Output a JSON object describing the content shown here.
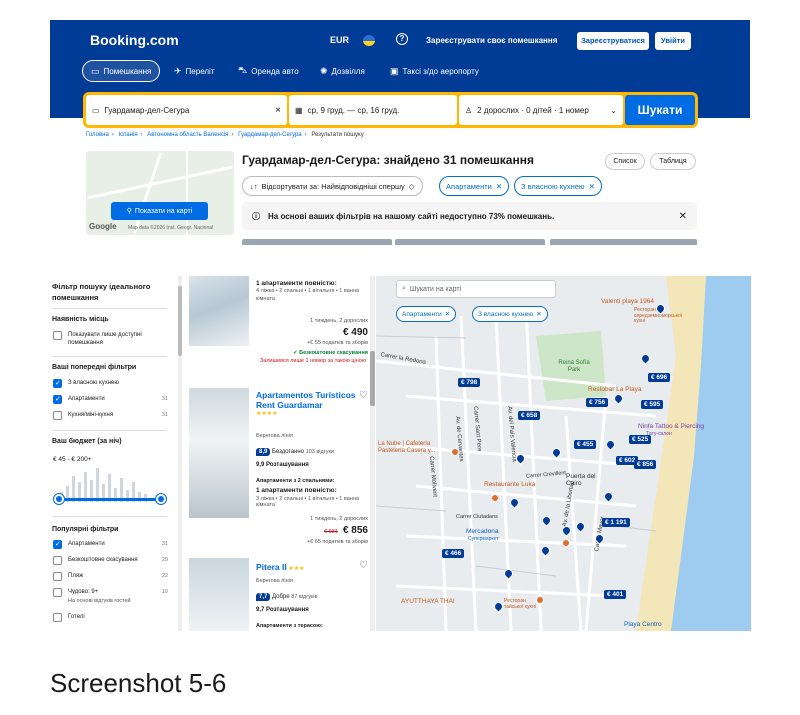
{
  "header": {
    "logo": "Booking.com",
    "currency": "EUR",
    "register_property": "Зареєструвати своє помешкання",
    "signup": "Зареєструватися",
    "signin": "Увійти",
    "nav": [
      "Помешкання",
      "Переліт",
      "Оренда авто",
      "Дозвілля",
      "Таксі з/до аеропорту"
    ]
  },
  "search": {
    "destination": "Гуардамар-дел-Сегура",
    "dates": "ср, 9 груд. — ср, 16 груд.",
    "guests": "2 дорослих · 0 дітей · 1 номер",
    "button": "Шукати"
  },
  "breadcrumbs": [
    "Головна",
    "Іспанія",
    "Автономна область Валенсія",
    "Гуардамар-дел-Сегура",
    "Результати пошуку"
  ],
  "results": {
    "map_button": "Показати на карті",
    "map_data": "Map data ©2026 Inst. Geogr. Nacional",
    "title": "Гуардамар-дел-Сегура: знайдено 31 помешкання",
    "view_list": "Список",
    "view_table": "Таблиця",
    "sort": "Відсортувати за: Найвідповідніші спершу",
    "chips": [
      "Апартаменти",
      "З власною кухнею"
    ],
    "notice": "На основі ваших фільтрів на нашому сайті недоступно 73% помешкань."
  },
  "filters": {
    "title": "Фільтр пошуку ідеального помешкання",
    "availability": "Наявність місць",
    "availability_item": "Показувати лише доступні помешкання",
    "previous": "Ваші попередні фільтри",
    "previous_items": [
      {
        "label": "З власною кухнею",
        "count": ""
      },
      {
        "label": "Апартаменти",
        "count": "31"
      },
      {
        "label": "Кухня/міні-кухня",
        "count": "31"
      }
    ],
    "budget": "Ваш бюджет (за ніч)",
    "budget_range": "€ 45 - € 200+",
    "popular": "Популярні фільтри",
    "popular_items": [
      {
        "label": "Апартаменти",
        "count": "31"
      },
      {
        "label": "Безкоштовне скасування",
        "count": "29"
      },
      {
        "label": "Пляж",
        "count": "22"
      },
      {
        "label": "Чудово: 9+",
        "count": "10"
      },
      {
        "label": "Готелі",
        "count": ""
      }
    ],
    "popular_sub": "На основі відгуків гостей"
  },
  "listings": [
    {
      "unit": "1 апартаменти повністю:",
      "beds": "4 ліжка • 2 спальні • 1 вітальня • 1 ванна кімната",
      "stay": "1 тиждень, 2 дорослих",
      "price": "€ 490",
      "fees": "+€ 55 податків та зборів",
      "free_cancel": "Безкоштовне скасування",
      "left": "Залишився лише 1 номер за такою ціною"
    },
    {
      "name": "Apartamentos Turísticos Rent Guardamar",
      "location": "Берегова лінія",
      "score": "8,9",
      "score_word": "Бездоганно",
      "reviews": "103 відгуки",
      "loc_score": "9,9 Розташування",
      "type": "Апартаменти з 2 спальнями:",
      "unit": "1 апартаменти повністю:",
      "beds": "3 ліжка • 2 спальні • 1 вітальня • 1 ванна кімната",
      "stay": "1 тиждень, 2 дорослих",
      "old_price": "€ 931",
      "price": "€ 856",
      "fees": "+€ 65 податків та зборів"
    },
    {
      "name": "Pitera II",
      "location": "Берегова лінія",
      "score": "7,7",
      "score_word": "Добре",
      "reviews": "87 відгуків",
      "loc_score": "9,7 Розташування",
      "type": "Апартаменти з терасою:"
    }
  ],
  "map": {
    "search_placeholder": "Шукати на карті",
    "chips": [
      "Апартаменти",
      "З власною кухнею"
    ],
    "prices": [
      "€ 798",
      "€ 658",
      "€ 756",
      "€ 595",
      "€ 696",
      "€ 455",
      "€ 525",
      "€ 602",
      "€ 856",
      "€ 1 191",
      "€ 466",
      "€ 401"
    ],
    "places": [
      "Valenti playa 1964",
      "Ресторан середземноморської кухні",
      "Carrer la Redona",
      "Reina Sofía Park",
      "Restobar La Playa",
      "Ninfa Tattoo & Piercing",
      "Тату-салон",
      "La Nube | Cafetería Pastelería Casera y...",
      "Carrer Mayor",
      "Av. del País Valencià",
      "Restaurante Luka",
      "Mercadona",
      "Супермаркет",
      "Puerta del Cairo",
      "Av. de la Libertad",
      "AYUTTHAYA THAI",
      "Ресторан тайської кухні",
      "Av. de Cervantes",
      "Playa Centro",
      "Carrer Ciutadans",
      "Carrer Crevillent",
      "Carrer Molivent",
      "Carrer Sant Pere"
    ]
  },
  "caption": "Screenshot 5-6",
  "colors": {
    "brand": "#003b95",
    "accent": "#006ce4",
    "search_border": "#ffb700"
  }
}
